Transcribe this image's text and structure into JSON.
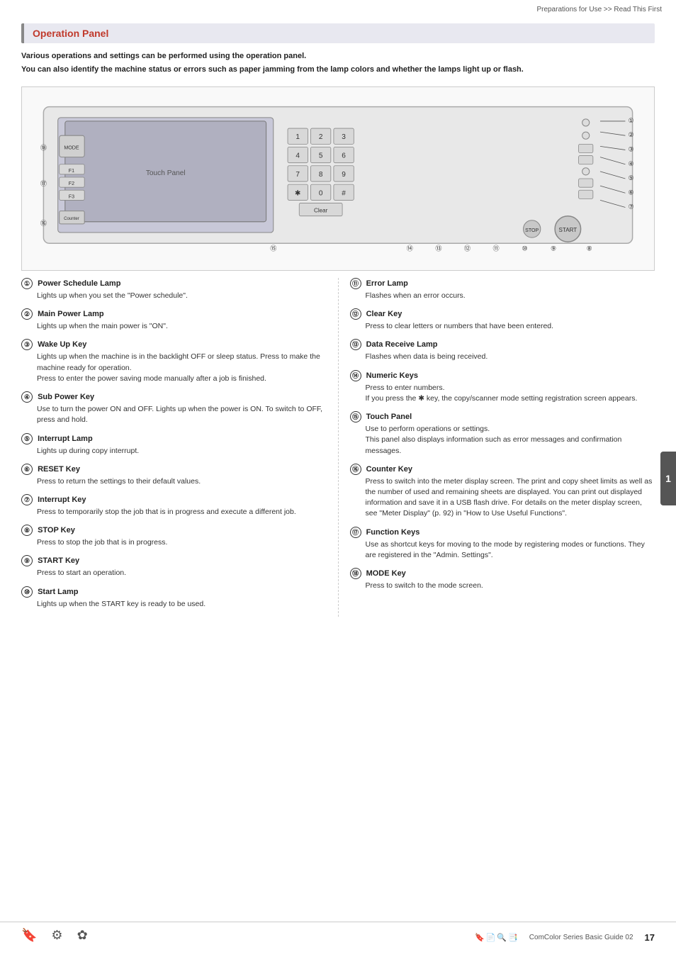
{
  "breadcrumb": "Preparations for Use >> Read This First",
  "section": {
    "title": "Operation Panel"
  },
  "intro": {
    "line1": "Various operations and settings can be performed using the operation panel.",
    "line2": "You can also identify the machine status or errors such as paper jamming from the lamp colors and whether the lamps light up or flash."
  },
  "items_left": [
    {
      "num": "①",
      "title": "Power Schedule Lamp",
      "body": "Lights up when you set the \"Power schedule\"."
    },
    {
      "num": "②",
      "title": "Main Power Lamp",
      "body": "Lights up when the main power is \"ON\"."
    },
    {
      "num": "③",
      "title": "Wake Up Key",
      "body": "Lights up when the machine is in the backlight OFF or sleep status. Press to make the machine ready for operation.\nPress to enter the power saving mode manually after a job is finished."
    },
    {
      "num": "④",
      "title": "Sub Power Key",
      "body": "Use to turn the power ON and OFF. Lights up when the power is ON. To switch to OFF, press and hold."
    },
    {
      "num": "⑤",
      "title": "Interrupt Lamp",
      "body": "Lights up during copy interrupt."
    },
    {
      "num": "⑥",
      "title": "RESET Key",
      "body": "Press to return the settings to their default values."
    },
    {
      "num": "⑦",
      "title": "Interrupt Key",
      "body": "Press to temporarily stop the job that is in progress and execute a different job."
    },
    {
      "num": "⑧",
      "title": "STOP Key",
      "body": "Press to stop the job that is in progress."
    },
    {
      "num": "⑨",
      "title": "START Key",
      "body": "Press to start an operation."
    },
    {
      "num": "⑩",
      "title": "Start Lamp",
      "body": "Lights up when the START key is ready to be used."
    }
  ],
  "items_right": [
    {
      "num": "⑪",
      "title": "Error Lamp",
      "body": "Flashes when an error occurs."
    },
    {
      "num": "⑫",
      "title": "Clear Key",
      "body": "Press to clear letters or numbers that have been entered."
    },
    {
      "num": "⑬",
      "title": "Data Receive Lamp",
      "body": "Flashes when data is being received."
    },
    {
      "num": "⑭",
      "title": "Numeric Keys",
      "body": "Press to enter numbers.\nIf you press the ✱ key, the copy/scanner mode setting registration screen appears."
    },
    {
      "num": "⑮",
      "title": "Touch Panel",
      "body": "Use to perform operations or settings.\nThis panel also displays information such as error messages and confirmation messages."
    },
    {
      "num": "⑯",
      "title": "Counter Key",
      "body": "Press to switch into the meter display screen. The print and copy sheet limits as well as the number of used and remaining sheets are displayed. You can print out displayed information and save it in a USB flash drive. For details on the meter display screen, see \"Meter Display\" (p. 92) in \"How to Use Useful Functions\"."
    },
    {
      "num": "⑰",
      "title": "Function Keys",
      "body": "Use as shortcut keys for moving to the mode by registering modes or functions. They are registered in the \"Admin. Settings\"."
    },
    {
      "num": "⑱",
      "title": "MODE Key",
      "body": "Press to switch to the mode screen."
    }
  ],
  "tab": "1",
  "footer": {
    "brand": "ComColor Series Basic Guide 02",
    "page": "17"
  }
}
